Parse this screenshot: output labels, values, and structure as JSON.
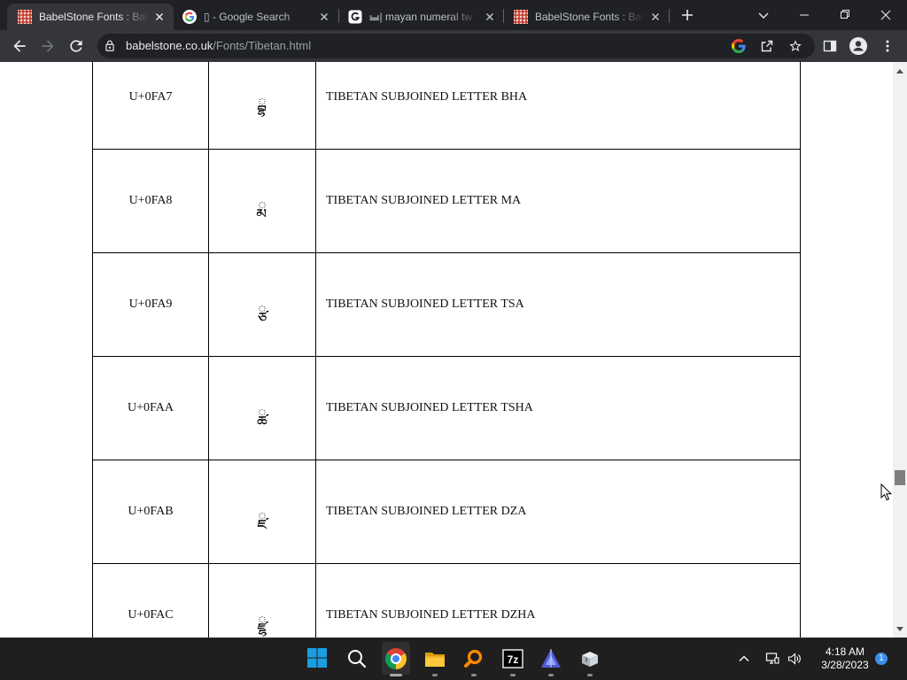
{
  "browser": {
    "tabs": [
      {
        "title": "BabelStone Fonts : Bab",
        "favicon": "babelstone-favicon",
        "active": true
      },
      {
        "title": "▯ - Google Search",
        "favicon": "google-favicon",
        "active": false
      },
      {
        "title": "𝋬| mayan numeral tw",
        "favicon": "google-square-favicon",
        "active": false
      },
      {
        "title": "BabelStone Fonts : Bab",
        "favicon": "babelstone-favicon",
        "active": false
      }
    ],
    "new_tab_icon": "plus-icon",
    "window_controls": [
      "chevron-down-icon",
      "minimize-icon",
      "restore-icon",
      "close-icon"
    ],
    "toolbar": {
      "nav_icons": [
        "back-arrow-icon",
        "forward-arrow-icon",
        "reload-icon"
      ],
      "url_host": "babelstone.co.uk",
      "url_path": "/Fonts/Tibetan.html",
      "omnibox_icons": [
        "lock-icon",
        "google-icon",
        "share-icon",
        "star-icon"
      ],
      "right_icons": [
        "side-panel-icon",
        "profile-icon",
        "menu-icon"
      ]
    }
  },
  "page": {
    "rows": [
      {
        "code": "U+0FA7",
        "glyph": "◌ྦྷ",
        "name": "TIBETAN SUBJOINED LETTER BHA"
      },
      {
        "code": "U+0FA8",
        "glyph": "◌ྨ",
        "name": "TIBETAN SUBJOINED LETTER MA"
      },
      {
        "code": "U+0FA9",
        "glyph": "◌ྩ",
        "name": "TIBETAN SUBJOINED LETTER TSA"
      },
      {
        "code": "U+0FAA",
        "glyph": "◌ྪ",
        "name": "TIBETAN SUBJOINED LETTER TSHA"
      },
      {
        "code": "U+0FAB",
        "glyph": "◌ྫ",
        "name": "TIBETAN SUBJOINED LETTER DZA"
      },
      {
        "code": "U+0FAC",
        "glyph": "◌ྫྷ",
        "name": "TIBETAN SUBJOINED LETTER DZHA"
      }
    ]
  },
  "taskbar": {
    "apps": [
      "windows-start-icon",
      "search-icon",
      "chrome-icon",
      "file-explorer-icon",
      "everything-search-icon",
      "7zip-icon",
      "triangle-app-icon",
      "box-app-icon"
    ],
    "seven_zip_label": "7z",
    "tray": {
      "icons": [
        "chevron-up-icon",
        "network-icon",
        "speaker-icon"
      ],
      "time": "4:18 AM",
      "date": "3/28/2023",
      "notification_count": "1"
    }
  },
  "colors": {
    "tab_strip": "#202124",
    "toolbar": "#35363a",
    "page_background": "#ffffff",
    "taskbar": "#1f1f1f",
    "notification_badge": "#3b8eea"
  }
}
